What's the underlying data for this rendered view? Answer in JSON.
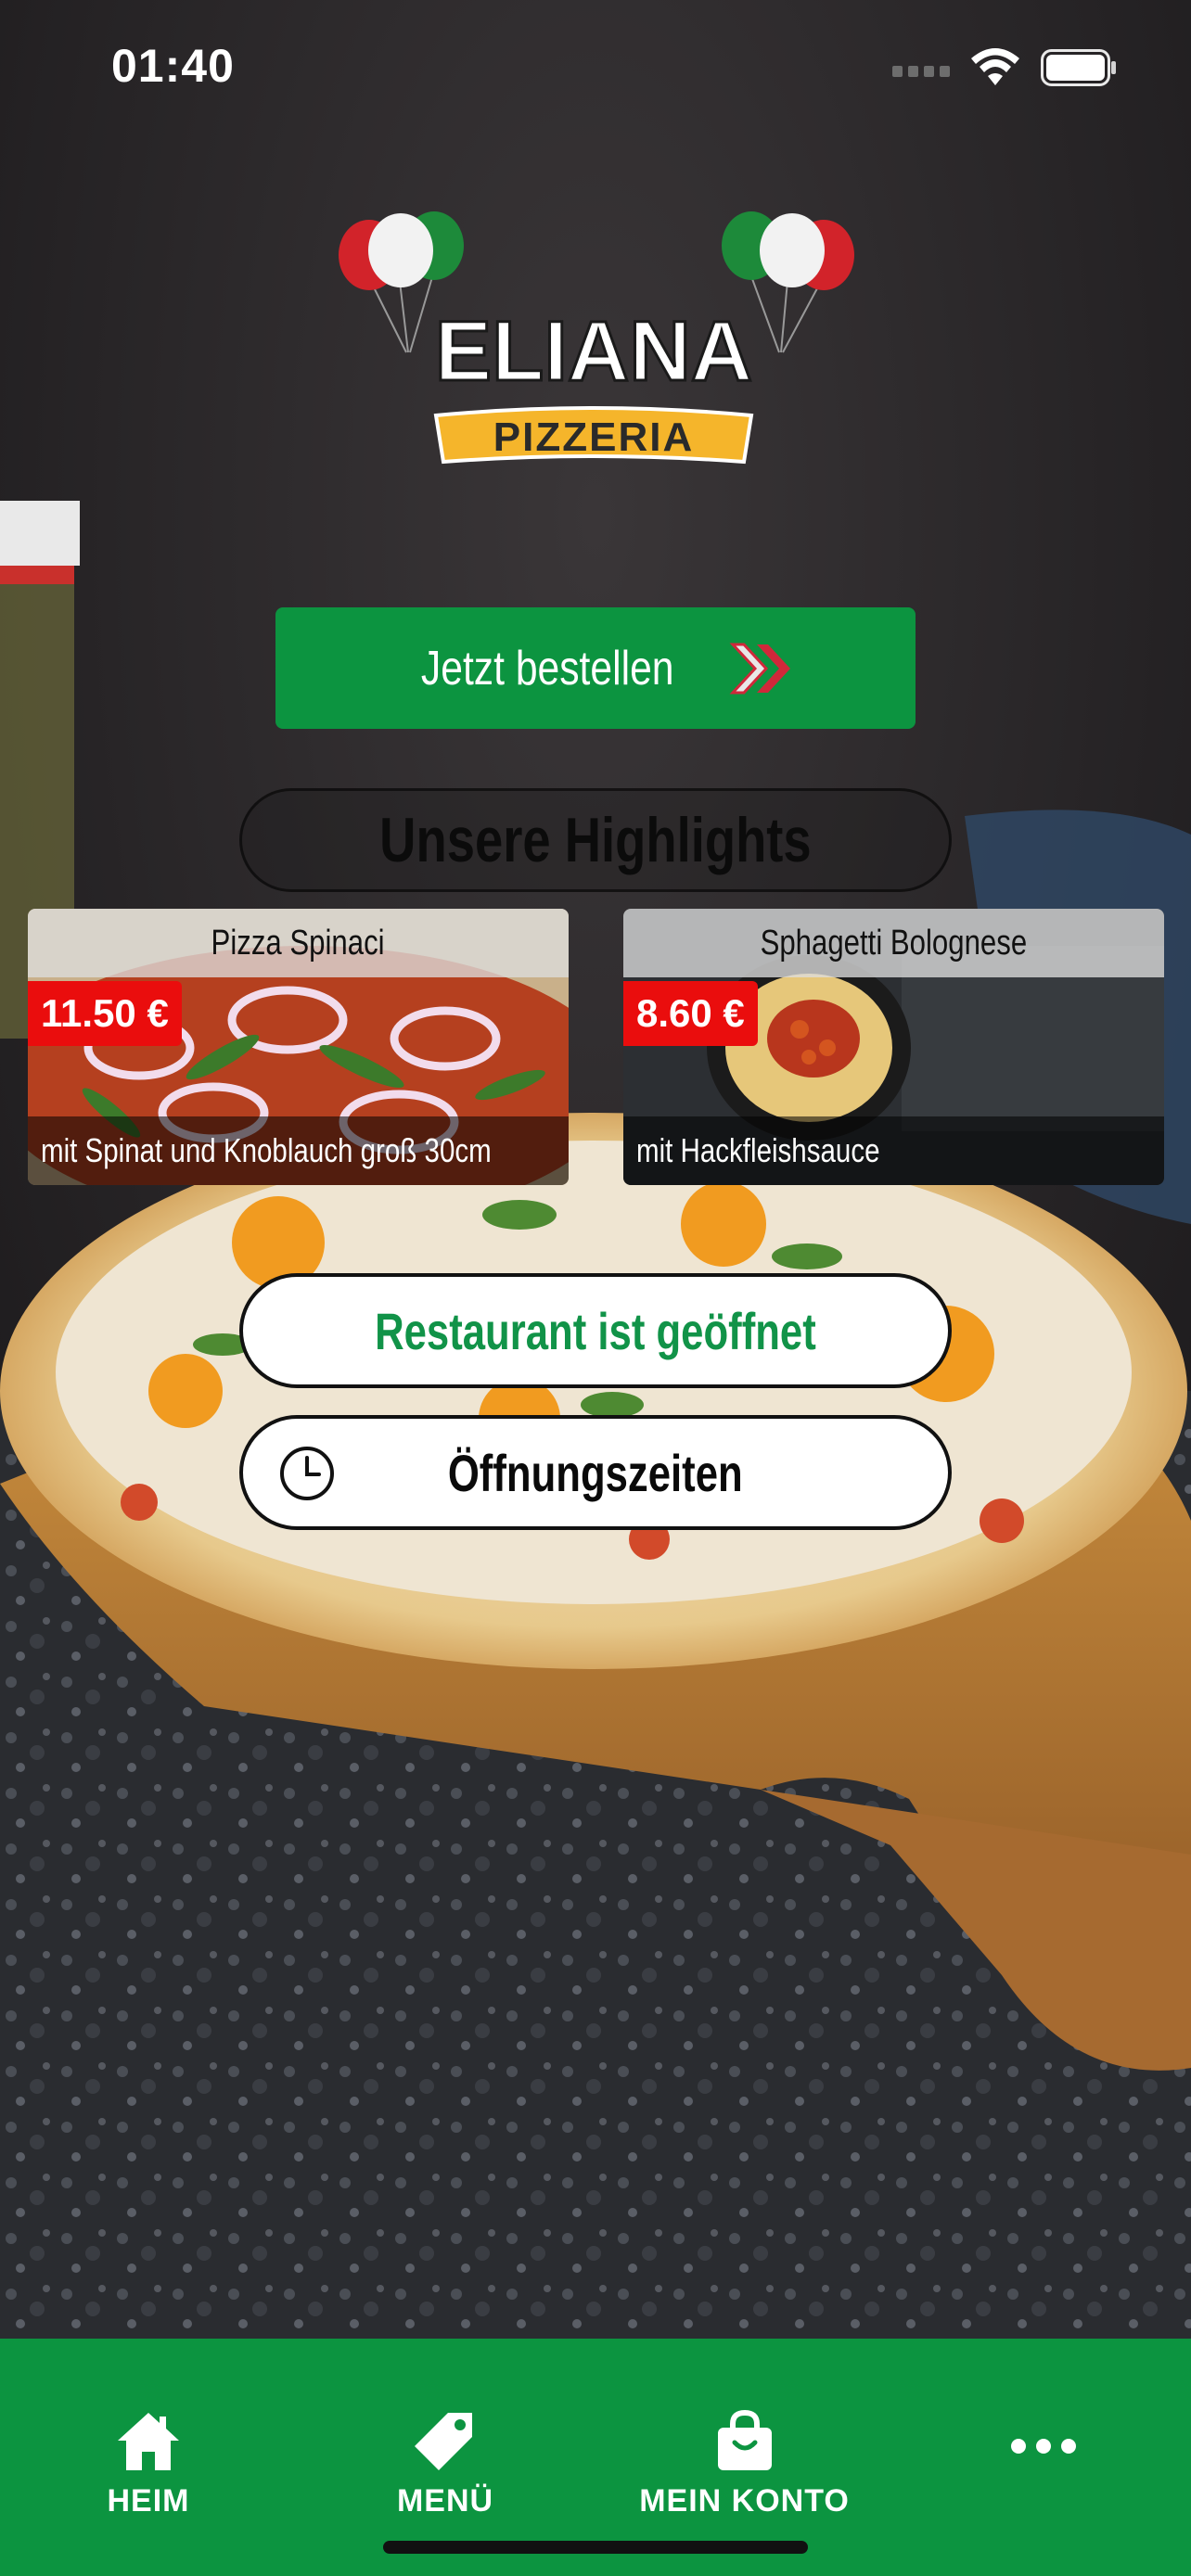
{
  "status_bar": {
    "time": "01:40"
  },
  "brand": {
    "name": "ELIANA",
    "subtitle": "PIZZERIA"
  },
  "order_button": {
    "label": "Jetzt bestellen"
  },
  "highlights": {
    "title": "Unsere Highlights",
    "items": [
      {
        "name": "Pizza Spinaci",
        "price": "11.50 €",
        "description": "mit Spinat und Knoblauch groß 30cm"
      },
      {
        "name": "Sphagetti Bolognese",
        "price": "8.60 €",
        "description": "mit Hackfleishsauce"
      }
    ]
  },
  "restaurant_status": {
    "label": "Restaurant ist geöffnet"
  },
  "opening_hours": {
    "label": "Öffnungszeiten"
  },
  "bottom_nav": {
    "items": [
      {
        "label": "HEIM",
        "icon": "home-icon"
      },
      {
        "label": "MENÜ",
        "icon": "tag-icon"
      },
      {
        "label": "MEIN KONTO",
        "icon": "shopping-bag-icon"
      },
      {
        "label": "",
        "icon": "more-dots-icon"
      }
    ]
  },
  "colors": {
    "brand_green": "#0c9440",
    "status_green": "#119348",
    "price_red": "#ea0d0d",
    "logo_yellow": "#f5b52b"
  }
}
